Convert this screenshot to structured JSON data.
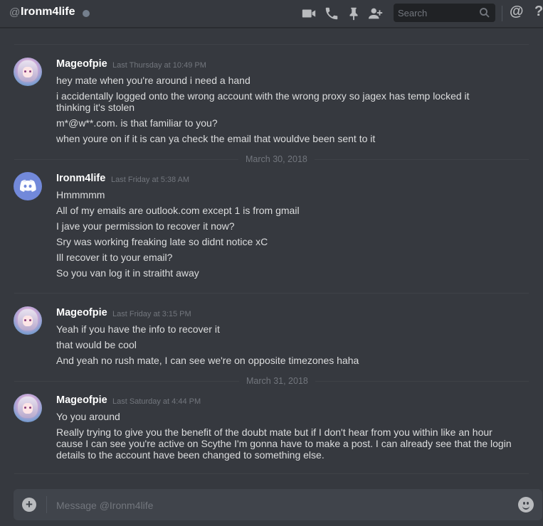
{
  "header": {
    "at_symbol": "@",
    "title": "Ironm4life",
    "search_placeholder": "Search",
    "mention_symbol": "@",
    "help_symbol": "?",
    "icons": [
      "video-call-icon",
      "voice-call-icon",
      "pin-icon",
      "add-friend-icon",
      "search-icon",
      "mentions-icon",
      "help-icon"
    ]
  },
  "messages": [
    {
      "username": "Mageofpie",
      "timestamp": "Last Thursday at 10:49 PM",
      "lines": [
        "hey mate when you're around i need a hand",
        "i accidentally logged onto the wrong account with the wrong proxy so jagex has temp locked it thinking it's stolen",
        "m*@w**.com. is that familiar to you?",
        "when youre on if it is can ya check the email that wouldve been sent to it"
      ]
    },
    {
      "username": "Ironm4life",
      "timestamp": "Last Friday at 5:38 AM",
      "lines": [
        "Hmmmmm",
        "All of my emails are outlook.com except 1 is from gmail",
        "I jave your permission to recover it now?",
        "Sry was working freaking late so didnt notice xC",
        "Ill recover it to your email?",
        "So you van log it in straitht away"
      ]
    },
    {
      "username": "Mageofpie",
      "timestamp": "Last Friday at 3:15 PM",
      "lines": [
        "Yeah if you have the info to recover it",
        "that would be cool",
        "And yeah no rush mate, I can see we're on opposite timezones haha"
      ]
    },
    {
      "username": "Mageofpie",
      "timestamp": "Last Saturday at 4:44 PM",
      "lines": [
        "Yo you around",
        "Really trying to give you the benefit of the doubt mate but if I don't hear from you within like an hour cause I can see you're active on Scythe I'm gonna have to make a post. I can already see that the login details to the account have been changed to something else."
      ]
    }
  ],
  "date_dividers": [
    "March 30, 2018",
    "March 31, 2018"
  ],
  "composer": {
    "placeholder": "Message @Ironm4life",
    "add_symbol": "+"
  },
  "colors": {
    "background": "#36393f",
    "composer": "#40444b",
    "username": "#ffffff",
    "text": "#dcddde",
    "muted": "#72767d",
    "discord_blurple": "#7289da"
  }
}
